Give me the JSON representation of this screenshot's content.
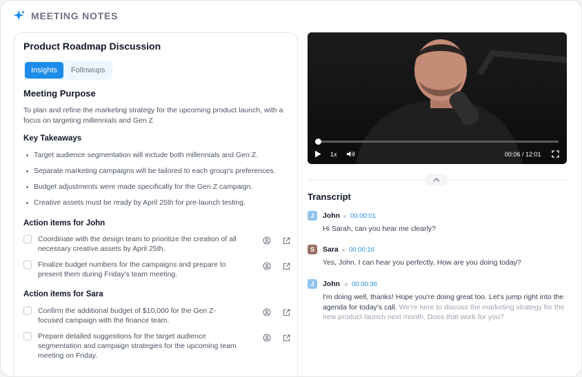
{
  "header": {
    "title": "MEETING NOTES",
    "icon": "sparkle-icon",
    "accent": "#1d8ce8"
  },
  "doc": {
    "title": "Product Roadmap Discussion",
    "tabs": [
      {
        "label": "Insights",
        "active": true
      },
      {
        "label": "Followups",
        "active": false
      }
    ],
    "purpose_heading": "Meeting Purpose",
    "purpose_text": "To plan and refine the marketing strategy for the upcoming product launch, with a focus on targeting millennials and Gen Z",
    "takeaways_heading": "Key Takeaways",
    "takeaways": [
      "Target audience segmentation will include both millennials and Gen Z.",
      "Separate marketing campaigns will be tailored to each group's preferences.",
      "Budget adjustments were made specifically for the Gen Z campaign.",
      "Creative assets must be ready by April 25th for pre-launch testing."
    ],
    "actions_john_heading": "Action items for John",
    "actions_john": [
      "Coordinate with the design team to prioritize the creation of all necessary creative assets by April 25th.",
      "Finalize budget numbers for the campaigns and prepare to present them during Friday's team meeting."
    ],
    "actions_sara_heading": "Action items for Sara",
    "actions_sara": [
      "Confirm the additional budget of $10,000 for the Gen Z-focused campaign with the finance team.",
      "Prepare detailed suggestions for the target audience segmentation and campaign strategies for the upcoming team meeting on Friday."
    ]
  },
  "video": {
    "speed": "1x",
    "time": "00:06 / 12:01",
    "progress": 0.008
  },
  "transcript": {
    "heading": "Transcript",
    "entries": [
      {
        "initial": "J",
        "speaker": "John",
        "time": "00:00:01",
        "color": "#8fc3ee",
        "text": "Hi Sarah, can you hear me clearly?",
        "faded": ""
      },
      {
        "initial": "S",
        "speaker": "Sara",
        "time": "00:00:16",
        "color": "#9a6f62",
        "text": "Yes, John. I can hear you perfectly. How are you doing today?",
        "faded": ""
      },
      {
        "initial": "J",
        "speaker": "John",
        "time": "00:00:36",
        "color": "#8fc3ee",
        "text": "I'm doing well, thanks! Hope you're doing great too. Let's jump right into the agenda for today's call.",
        "faded": "We're here to discuss the marketing strategy for the new product launch next month. Does that work for you?"
      }
    ]
  }
}
